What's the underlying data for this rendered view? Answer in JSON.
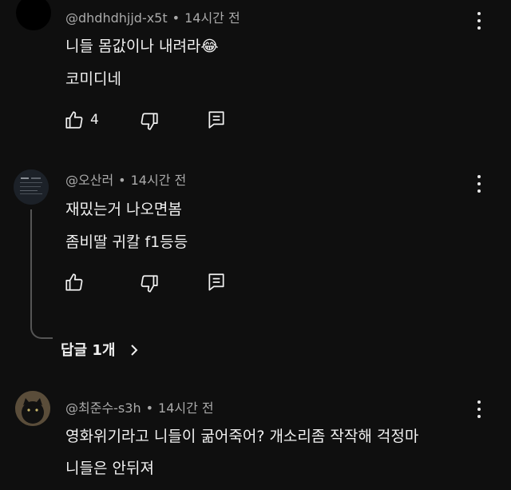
{
  "comments": [
    {
      "author": "@dhdhdhjjd-x5t",
      "time": "14시간 전",
      "lines": [
        "니들 몸값이나 내려라😂",
        "코미디네"
      ],
      "likes": "4"
    },
    {
      "author": "@오산러",
      "time": "14시간 전",
      "lines": [
        "재밌는거 나오면봄",
        "좀비딸 귀칼 f1등등"
      ],
      "likes": "",
      "replies_label": "답글 1개"
    },
    {
      "author": "@최준수-s3h",
      "time": "14시간 전",
      "lines": [
        "영화위기라고 니들이 굶어죽어? 개소리좀 작작해 걱정마",
        "니들은 안뒤져"
      ]
    }
  ],
  "icons": {
    "like": "thumbs-up-icon",
    "dislike": "thumbs-down-icon",
    "reply": "reply-icon",
    "more": "more-vertical-icon",
    "chevron": "chevron-right-icon"
  },
  "colors": {
    "background": "#0f0f0f",
    "text": "#f1f1f1",
    "meta": "#aaaaaa"
  }
}
